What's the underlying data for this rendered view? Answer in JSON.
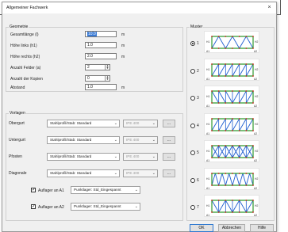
{
  "window": {
    "title": "Allgemeiner Fachwerk",
    "close_glyph": "×"
  },
  "geometry": {
    "legend": "Geometrie",
    "fields": [
      {
        "label": "Gesamtlänge (l)",
        "value": "10.0",
        "unit": "m",
        "selected": true
      },
      {
        "label": "Höhe links (h1)",
        "value": "1.0",
        "unit": "m"
      },
      {
        "label": "Höhe rechts (h2)",
        "value": "2.0",
        "unit": "m"
      }
    ],
    "spins": [
      {
        "label": "Anzahl Felder (a)",
        "value": "2"
      },
      {
        "label": "Anzahl der Kopien",
        "value": "0"
      }
    ],
    "distance": {
      "label": "Abstand",
      "value": "1.0",
      "unit": "m"
    }
  },
  "templates": {
    "legend": "Vorlagen",
    "rows": [
      {
        "label": "Obergurt",
        "profile": "Stahlprofil/Stab: Standard",
        "section": "IPE 400"
      },
      {
        "label": "Untergurt",
        "profile": "Stahlprofil/Stab: Standard",
        "section": "IPE 400"
      },
      {
        "label": "Pfosten",
        "profile": "Stahlprofil/Stab: Standard",
        "section": "IPE 400"
      },
      {
        "label": "Diagonale",
        "profile": "Stahlprofil/Stab: Standard",
        "section": "IPE 400"
      }
    ],
    "browse_label": "...",
    "supports": [
      {
        "label": "Auflager an A1",
        "value": "Punktlager: Std_Eingespannt",
        "checked": true
      },
      {
        "label": "Auflager an A2",
        "value": "Punktlager: Std_Eingespannt",
        "checked": true
      }
    ]
  },
  "pattern": {
    "legend": "Muster",
    "options": [
      "1",
      "2",
      "3",
      "4",
      "5",
      "6",
      "7"
    ],
    "selected": "1",
    "node_labels": {
      "a": "A1",
      "b": "A2",
      "left": "H1",
      "right": "H2"
    }
  },
  "buttons": {
    "ok": "OK",
    "cancel": "Abbrechen",
    "help": "Hilfe"
  },
  "colors": {
    "chord": "#2f9a2f",
    "web": "#1f5fd0",
    "node": "#d02020",
    "accent": "#3a7bd5"
  },
  "icons": {
    "close": "close-icon",
    "spin": "spin-arrows-icon",
    "dropdown": "chevron-down-icon",
    "check": "checkmark-icon"
  }
}
